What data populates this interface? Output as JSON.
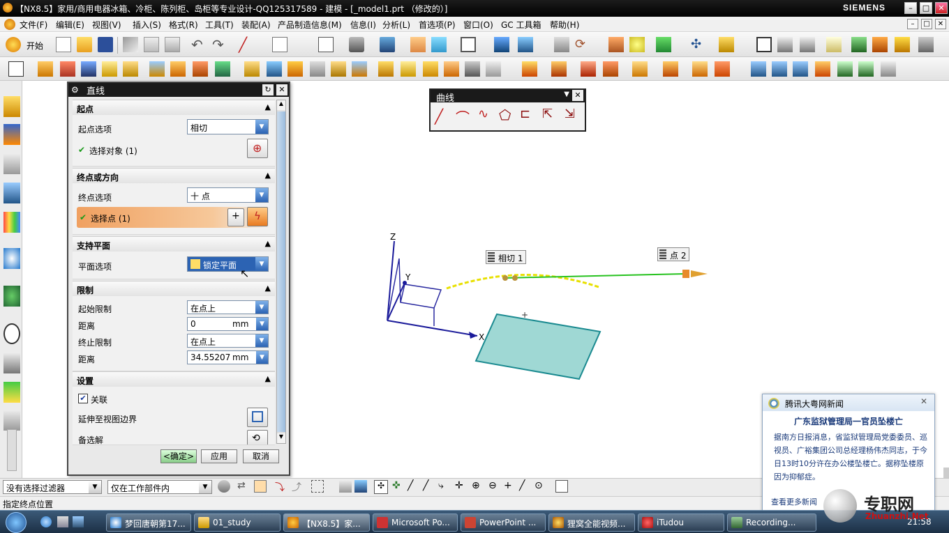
{
  "window": {
    "title": "【NX8.5】家用/商用电器冰箱、冷柜、陈列柜、岛柜等专业设计-QQ125317589 - 建模 - [_model1.prt （修改的）]",
    "brand": "SIEMENS",
    "controls": {
      "minimize": "–",
      "maximize": "□",
      "close": "✕"
    }
  },
  "menubar": {
    "items": [
      "文件(F)",
      "编辑(E)",
      "视图(V)",
      "插入(S)",
      "格式(R)",
      "工具(T)",
      "装配(A)",
      "产品制造信息(M)",
      "信息(I)",
      "分析(L)",
      "首选项(P)",
      "窗口(O)",
      "GC 工具箱",
      "帮助(H)"
    ]
  },
  "toolbar": {
    "start_label": "开始"
  },
  "dialog": {
    "title": "直线",
    "start": {
      "header": "起点",
      "option_label": "起点选项",
      "option_value": "相切",
      "select_label": "选择对象 (1)"
    },
    "end": {
      "header": "终点或方向",
      "option_label": "终点选项",
      "option_value": "十 点",
      "select_label": "选择点 (1)"
    },
    "plane": {
      "header": "支持平面",
      "option_label": "平面选项",
      "option_value": "锁定平面"
    },
    "limits": {
      "header": "限制",
      "start_limit_label": "起始限制",
      "start_limit_value": "在点上",
      "distance1_label": "距离",
      "distance1_value": "0",
      "distance1_unit": "mm",
      "end_limit_label": "终止限制",
      "end_limit_value": "在点上",
      "distance2_label": "距离",
      "distance2_value": "34.55207",
      "distance2_unit": "mm"
    },
    "settings": {
      "header": "设置",
      "associative_label": "关联",
      "extend_label": "延伸至视图边界",
      "alt_label": "备选解"
    },
    "buttons": {
      "ok": "<确定>",
      "apply": "应用",
      "cancel": "取消"
    }
  },
  "curve_toolbar": {
    "title": "曲线"
  },
  "viewport": {
    "tag_tangent": "相切 1",
    "tag_point": "点 2",
    "axis_x": "X",
    "axis_y": "Y",
    "axis_z": "Z"
  },
  "filterbar": {
    "filter_value": "没有选择过滤器",
    "scope_value": "仅在工作部件内"
  },
  "status": {
    "prompt": "指定终点位置"
  },
  "taskbar": {
    "items": [
      "梦回唐朝第17...",
      "01_study",
      "【NX8.5】家...",
      "Microsoft Po...",
      "PowerPoint ...",
      "狸窝全能视频...",
      "iTudou",
      "Recording..."
    ],
    "clock": "21:58"
  },
  "news": {
    "source": "腾讯大粤网新闻",
    "headline": "广东监狱管理局一官员坠楼亡",
    "body": "据南方日报消息，省监狱管理局党委委员、巡视员、广裕集团公司总经理杨伟杰同志，于今日13时10分许在办公楼坠楼亡。据称坠楼原因为抑郁症。",
    "more": "查看更多新闻"
  },
  "watermark": {
    "text": "专职网",
    "url": "Zhuanzhi.Net"
  },
  "colors": {
    "accent": "#2c63b3",
    "highlight_row": "#f0a060",
    "plane": "#9fd8d4",
    "curve_yellow": "#e8e000",
    "line_green": "#27c21f"
  }
}
